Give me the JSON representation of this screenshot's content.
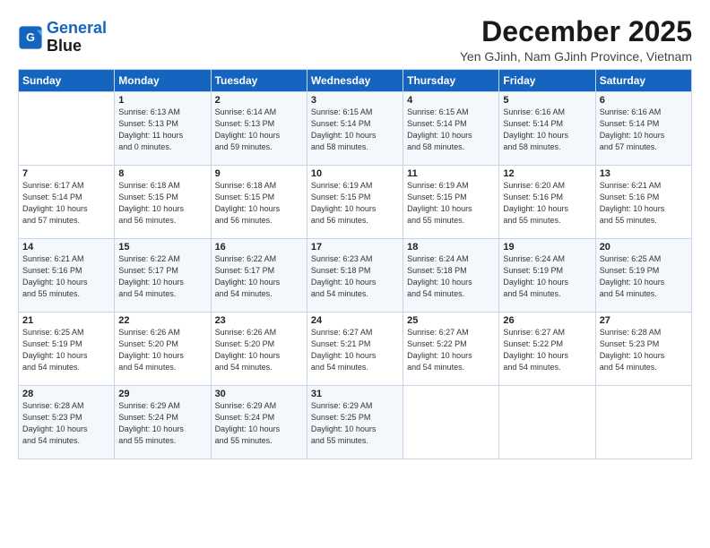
{
  "logo": {
    "line1": "General",
    "line2": "Blue"
  },
  "title": "December 2025",
  "subtitle": "Yen GJinh, Nam GJinh Province, Vietnam",
  "weekdays": [
    "Sunday",
    "Monday",
    "Tuesday",
    "Wednesday",
    "Thursday",
    "Friday",
    "Saturday"
  ],
  "weeks": [
    [
      {
        "day": "",
        "info": ""
      },
      {
        "day": "1",
        "info": "Sunrise: 6:13 AM\nSunset: 5:13 PM\nDaylight: 11 hours\nand 0 minutes."
      },
      {
        "day": "2",
        "info": "Sunrise: 6:14 AM\nSunset: 5:13 PM\nDaylight: 10 hours\nand 59 minutes."
      },
      {
        "day": "3",
        "info": "Sunrise: 6:15 AM\nSunset: 5:14 PM\nDaylight: 10 hours\nand 58 minutes."
      },
      {
        "day": "4",
        "info": "Sunrise: 6:15 AM\nSunset: 5:14 PM\nDaylight: 10 hours\nand 58 minutes."
      },
      {
        "day": "5",
        "info": "Sunrise: 6:16 AM\nSunset: 5:14 PM\nDaylight: 10 hours\nand 58 minutes."
      },
      {
        "day": "6",
        "info": "Sunrise: 6:16 AM\nSunset: 5:14 PM\nDaylight: 10 hours\nand 57 minutes."
      }
    ],
    [
      {
        "day": "7",
        "info": "Sunrise: 6:17 AM\nSunset: 5:14 PM\nDaylight: 10 hours\nand 57 minutes."
      },
      {
        "day": "8",
        "info": "Sunrise: 6:18 AM\nSunset: 5:15 PM\nDaylight: 10 hours\nand 56 minutes."
      },
      {
        "day": "9",
        "info": "Sunrise: 6:18 AM\nSunset: 5:15 PM\nDaylight: 10 hours\nand 56 minutes."
      },
      {
        "day": "10",
        "info": "Sunrise: 6:19 AM\nSunset: 5:15 PM\nDaylight: 10 hours\nand 56 minutes."
      },
      {
        "day": "11",
        "info": "Sunrise: 6:19 AM\nSunset: 5:15 PM\nDaylight: 10 hours\nand 55 minutes."
      },
      {
        "day": "12",
        "info": "Sunrise: 6:20 AM\nSunset: 5:16 PM\nDaylight: 10 hours\nand 55 minutes."
      },
      {
        "day": "13",
        "info": "Sunrise: 6:21 AM\nSunset: 5:16 PM\nDaylight: 10 hours\nand 55 minutes."
      }
    ],
    [
      {
        "day": "14",
        "info": "Sunrise: 6:21 AM\nSunset: 5:16 PM\nDaylight: 10 hours\nand 55 minutes."
      },
      {
        "day": "15",
        "info": "Sunrise: 6:22 AM\nSunset: 5:17 PM\nDaylight: 10 hours\nand 54 minutes."
      },
      {
        "day": "16",
        "info": "Sunrise: 6:22 AM\nSunset: 5:17 PM\nDaylight: 10 hours\nand 54 minutes."
      },
      {
        "day": "17",
        "info": "Sunrise: 6:23 AM\nSunset: 5:18 PM\nDaylight: 10 hours\nand 54 minutes."
      },
      {
        "day": "18",
        "info": "Sunrise: 6:24 AM\nSunset: 5:18 PM\nDaylight: 10 hours\nand 54 minutes."
      },
      {
        "day": "19",
        "info": "Sunrise: 6:24 AM\nSunset: 5:19 PM\nDaylight: 10 hours\nand 54 minutes."
      },
      {
        "day": "20",
        "info": "Sunrise: 6:25 AM\nSunset: 5:19 PM\nDaylight: 10 hours\nand 54 minutes."
      }
    ],
    [
      {
        "day": "21",
        "info": "Sunrise: 6:25 AM\nSunset: 5:19 PM\nDaylight: 10 hours\nand 54 minutes."
      },
      {
        "day": "22",
        "info": "Sunrise: 6:26 AM\nSunset: 5:20 PM\nDaylight: 10 hours\nand 54 minutes."
      },
      {
        "day": "23",
        "info": "Sunrise: 6:26 AM\nSunset: 5:20 PM\nDaylight: 10 hours\nand 54 minutes."
      },
      {
        "day": "24",
        "info": "Sunrise: 6:27 AM\nSunset: 5:21 PM\nDaylight: 10 hours\nand 54 minutes."
      },
      {
        "day": "25",
        "info": "Sunrise: 6:27 AM\nSunset: 5:22 PM\nDaylight: 10 hours\nand 54 minutes."
      },
      {
        "day": "26",
        "info": "Sunrise: 6:27 AM\nSunset: 5:22 PM\nDaylight: 10 hours\nand 54 minutes."
      },
      {
        "day": "27",
        "info": "Sunrise: 6:28 AM\nSunset: 5:23 PM\nDaylight: 10 hours\nand 54 minutes."
      }
    ],
    [
      {
        "day": "28",
        "info": "Sunrise: 6:28 AM\nSunset: 5:23 PM\nDaylight: 10 hours\nand 54 minutes."
      },
      {
        "day": "29",
        "info": "Sunrise: 6:29 AM\nSunset: 5:24 PM\nDaylight: 10 hours\nand 55 minutes."
      },
      {
        "day": "30",
        "info": "Sunrise: 6:29 AM\nSunset: 5:24 PM\nDaylight: 10 hours\nand 55 minutes."
      },
      {
        "day": "31",
        "info": "Sunrise: 6:29 AM\nSunset: 5:25 PM\nDaylight: 10 hours\nand 55 minutes."
      },
      {
        "day": "",
        "info": ""
      },
      {
        "day": "",
        "info": ""
      },
      {
        "day": "",
        "info": ""
      }
    ]
  ]
}
